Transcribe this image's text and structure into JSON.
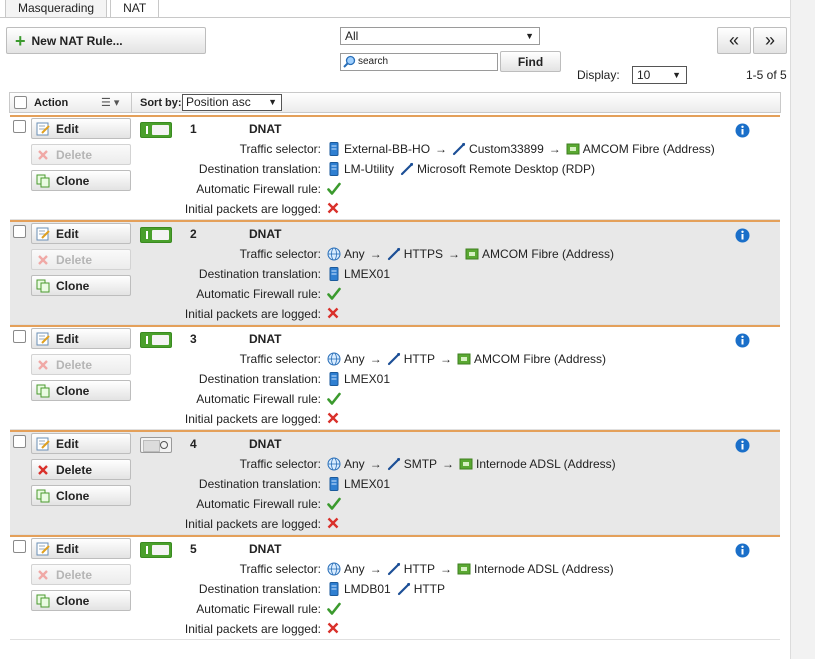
{
  "tabs": [
    {
      "label": "Masquerading",
      "active": false
    },
    {
      "label": "NAT",
      "active": true
    }
  ],
  "toolbar": {
    "new_rule_label": "New NAT Rule...",
    "filter_value": "All",
    "search_placeholder": "search",
    "find_label": "Find",
    "prev_label": "«",
    "next_label": "»",
    "display_label": "Display:",
    "display_value": "10",
    "range_text": "1-5 of 5"
  },
  "table_header": {
    "action_label": "Action",
    "sortby_label": "Sort by:",
    "sort_value": "Position asc"
  },
  "labels": {
    "edit": "Edit",
    "delete": "Delete",
    "clone": "Clone",
    "traffic_selector": "Traffic selector:",
    "destination_translation": "Destination translation:",
    "auto_fw_rule": "Automatic Firewall rule:",
    "initial_logged": "Initial packets are logged:"
  },
  "arrow": "→",
  "colors": {
    "accent_orange": "#e4a05a",
    "toggle_green": "#4aa02c",
    "check_green": "#3b9a2e",
    "cross_red": "#d9302a",
    "info_blue": "#1a6fc9"
  },
  "rules": [
    {
      "number": "1",
      "type": "DNAT",
      "enabled": true,
      "delete_enabled": false,
      "traffic": [
        {
          "icon": "server-icon",
          "text": "External-BB-HO"
        },
        {
          "icon": "service-icon",
          "text": "Custom33899"
        },
        {
          "icon": "network-icon",
          "text": "AMCOM Fibre (Address)"
        }
      ],
      "dest": [
        {
          "icon": "server-icon",
          "text": "LM-Utility"
        },
        {
          "icon": "service-icon",
          "text": "Microsoft Remote Desktop (RDP)"
        }
      ],
      "auto_fw": true,
      "logged": false
    },
    {
      "number": "2",
      "type": "DNAT",
      "enabled": true,
      "delete_enabled": false,
      "traffic": [
        {
          "icon": "globe-icon",
          "text": "Any"
        },
        {
          "icon": "service-icon",
          "text": "HTTPS"
        },
        {
          "icon": "network-icon",
          "text": "AMCOM Fibre (Address)"
        }
      ],
      "dest": [
        {
          "icon": "server-icon",
          "text": "LMEX01"
        }
      ],
      "auto_fw": true,
      "logged": false
    },
    {
      "number": "3",
      "type": "DNAT",
      "enabled": true,
      "delete_enabled": false,
      "traffic": [
        {
          "icon": "globe-icon",
          "text": "Any"
        },
        {
          "icon": "service-icon",
          "text": "HTTP"
        },
        {
          "icon": "network-icon",
          "text": "AMCOM Fibre (Address)"
        }
      ],
      "dest": [
        {
          "icon": "server-icon",
          "text": "LMEX01"
        }
      ],
      "auto_fw": true,
      "logged": false
    },
    {
      "number": "4",
      "type": "DNAT",
      "enabled": false,
      "delete_enabled": true,
      "traffic": [
        {
          "icon": "globe-icon",
          "text": "Any"
        },
        {
          "icon": "service-icon",
          "text": "SMTP"
        },
        {
          "icon": "network-icon",
          "text": "Internode ADSL (Address)"
        }
      ],
      "dest": [
        {
          "icon": "server-icon",
          "text": "LMEX01"
        }
      ],
      "auto_fw": true,
      "logged": false
    },
    {
      "number": "5",
      "type": "DNAT",
      "enabled": true,
      "delete_enabled": false,
      "traffic": [
        {
          "icon": "globe-icon",
          "text": "Any"
        },
        {
          "icon": "service-icon",
          "text": "HTTP"
        },
        {
          "icon": "network-icon",
          "text": "Internode ADSL (Address)"
        }
      ],
      "dest": [
        {
          "icon": "server-icon",
          "text": "LMDB01"
        },
        {
          "icon": "service-icon",
          "text": "HTTP"
        }
      ],
      "auto_fw": true,
      "logged": false
    }
  ]
}
